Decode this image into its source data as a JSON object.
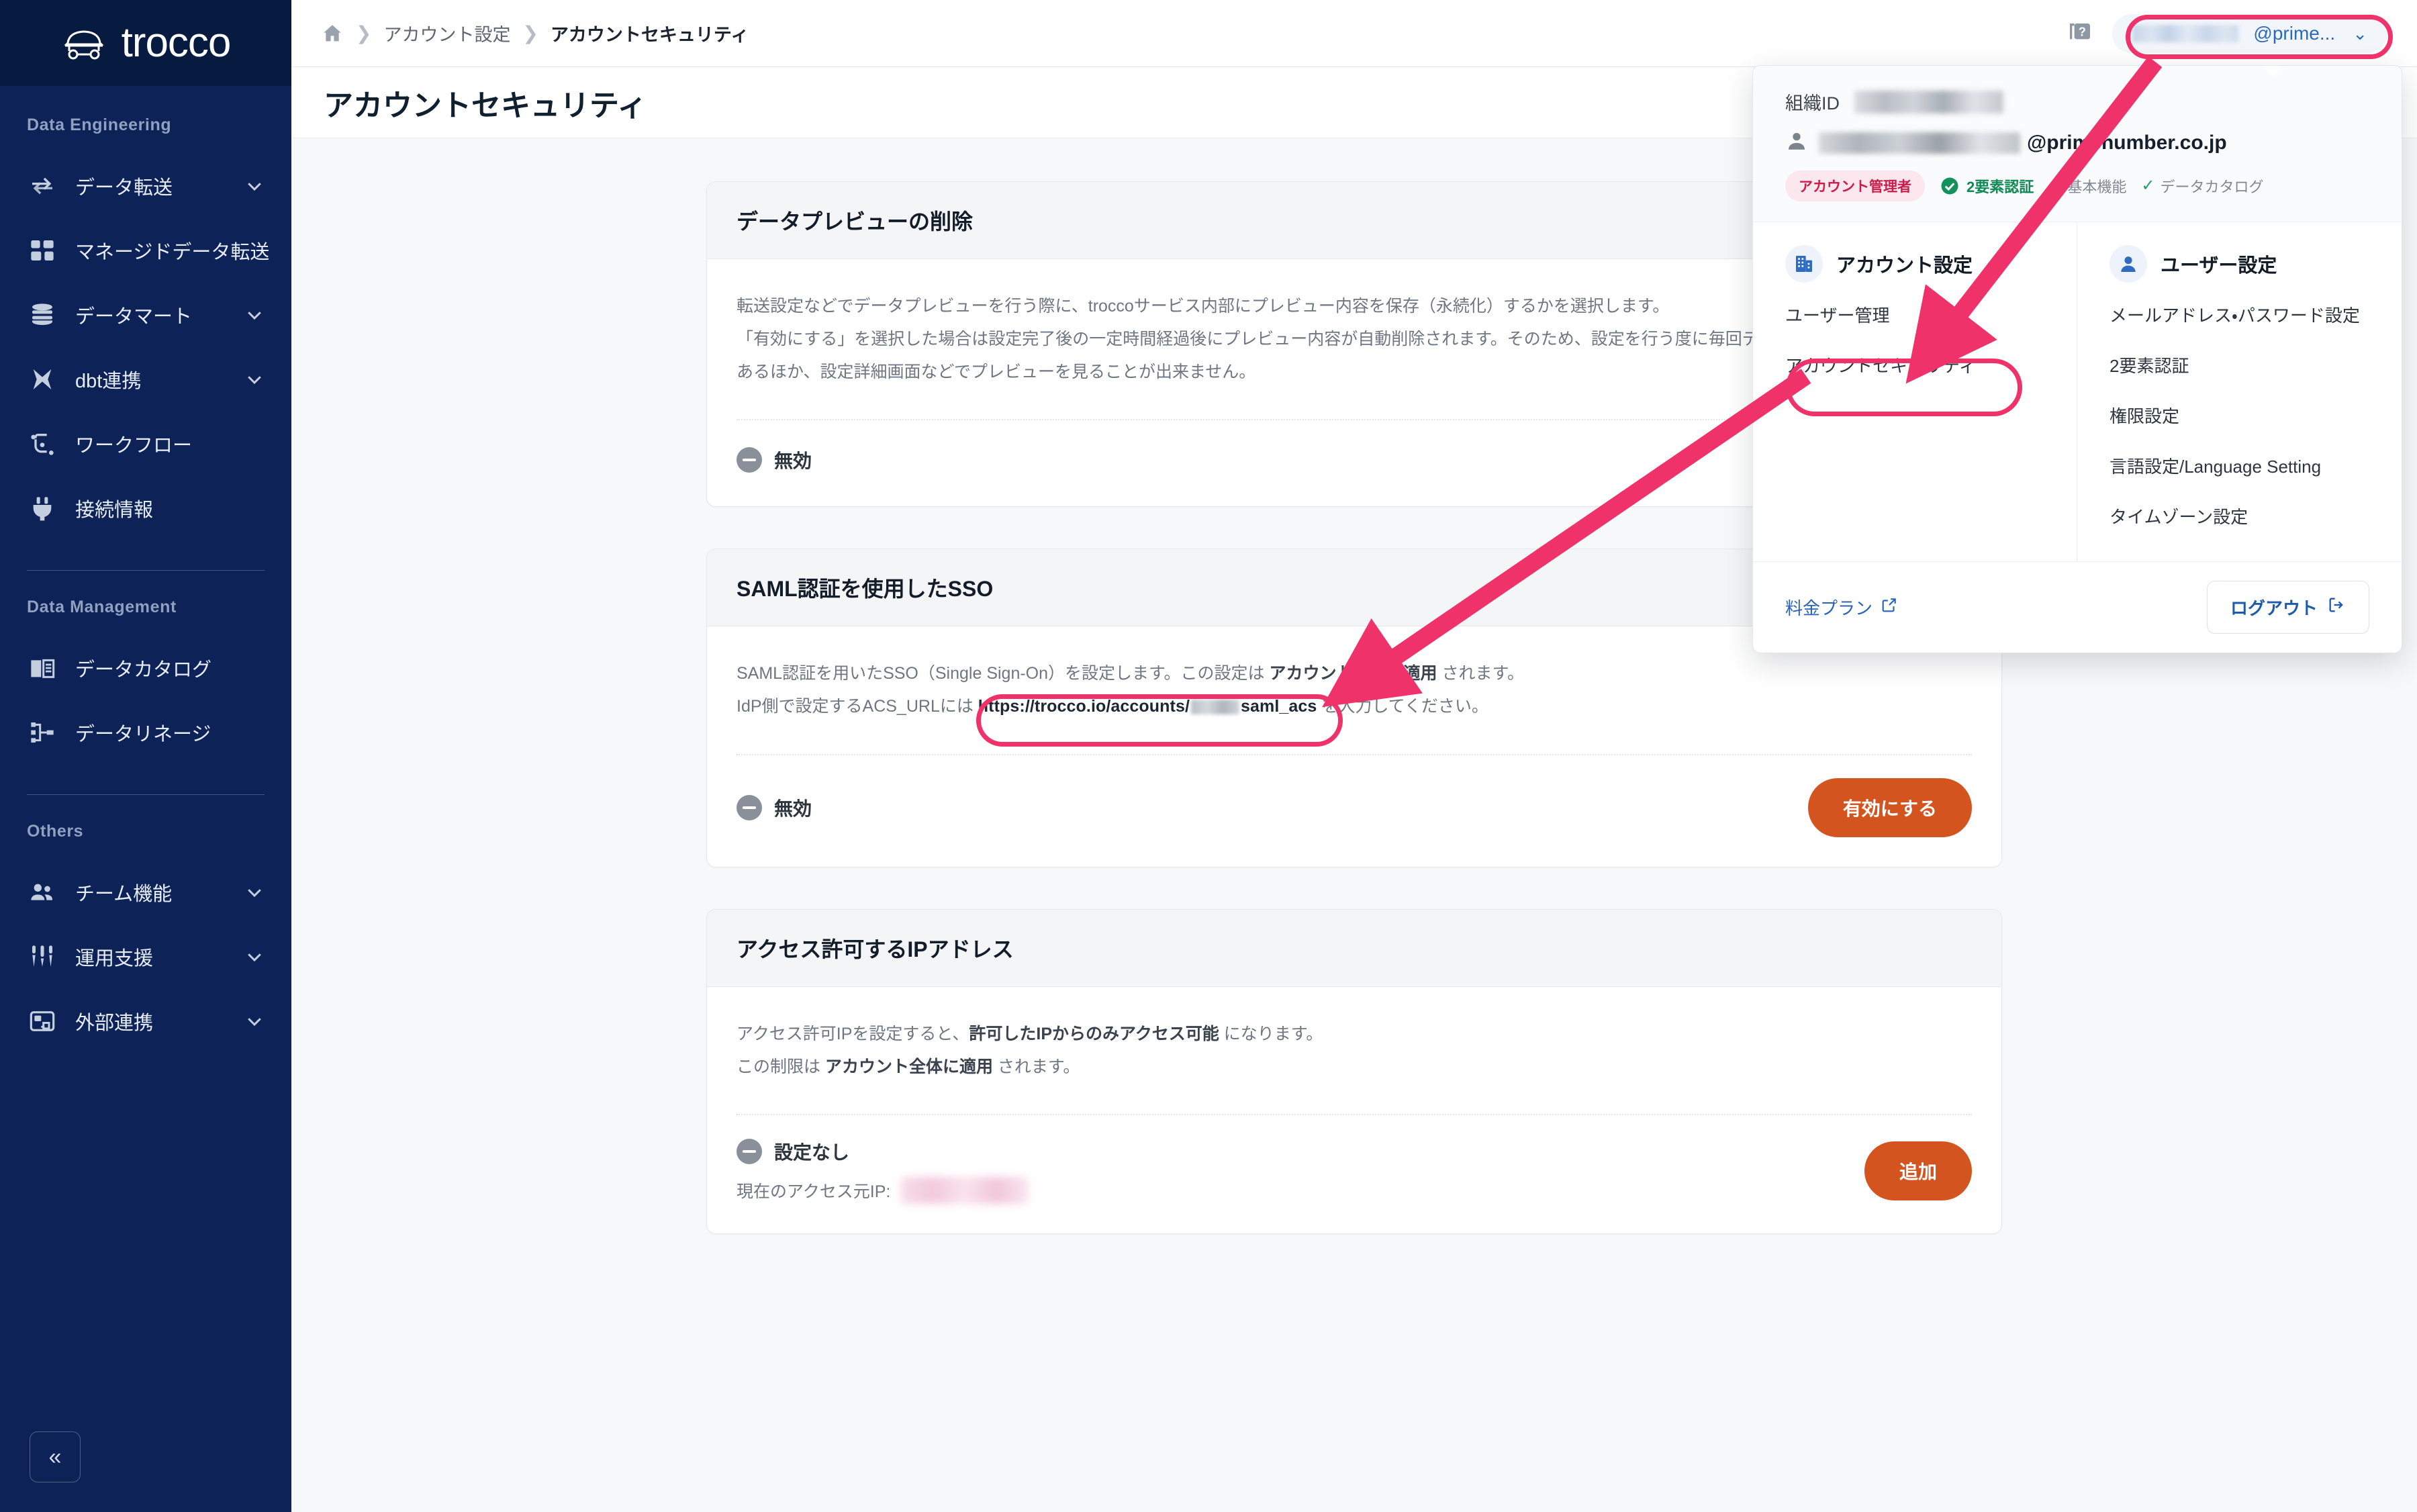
{
  "brand": {
    "name": "trocco",
    "logo_icon": "trocco-cart-icon"
  },
  "sidebar": {
    "sections": [
      {
        "label": "Data Engineering",
        "items": [
          {
            "label": "データ転送",
            "icon": "transfer-icon",
            "chevron": true
          },
          {
            "label": "マネージドデータ転送",
            "icon": "managed-transfer-icon",
            "chevron": false
          },
          {
            "label": "データマート",
            "icon": "database-icon",
            "chevron": true
          },
          {
            "label": "dbt連携",
            "icon": "dbt-icon",
            "chevron": true
          },
          {
            "label": "ワークフロー",
            "icon": "workflow-icon",
            "chevron": false
          },
          {
            "label": "接続情報",
            "icon": "plug-icon",
            "chevron": false
          }
        ]
      },
      {
        "label": "Data Management",
        "items": [
          {
            "label": "データカタログ",
            "icon": "book-icon",
            "chevron": false
          },
          {
            "label": "データリネージ",
            "icon": "lineage-icon",
            "chevron": false
          }
        ]
      },
      {
        "label": "Others",
        "items": [
          {
            "label": "チーム機能",
            "icon": "team-icon",
            "chevron": true
          },
          {
            "label": "運用支援",
            "icon": "sliders-icon",
            "chevron": true
          },
          {
            "label": "外部連携",
            "icon": "external-link-icon",
            "chevron": true
          }
        ]
      }
    ],
    "collapse_label": "«"
  },
  "topbar": {
    "breadcrumb": {
      "home_icon": "home-icon",
      "separator": "❯",
      "parent": "アカウント設定",
      "current": "アカウントセキュリティ"
    },
    "help_icon": "help-icon",
    "user_chip": {
      "text": "@prime...",
      "chevron": "⌄",
      "masked": true
    }
  },
  "page": {
    "title": "アカウントセキュリティ"
  },
  "cards": [
    {
      "title": "データプレビューの削除",
      "lines": [
        "転送設定などでデータプレビューを行う際に、troccoサービス内部にプレビュー内容を保存（永続化）するかを選択します。",
        "「有効にする」を選択した場合は設定完了後の一定時間経過後にプレビュー内容が自動削除されます。そのため、設定を行う度に毎回データプレ",
        "あるほか、設定詳細画面などでプレビューを見ることが出来ません。"
      ],
      "status": "無効",
      "status_icon": "minus-circle-icon",
      "button": null
    },
    {
      "title": "SAML認証を使用したSSO",
      "line1_prefix": "SAML認証を用いたSSO（Single Sign-On）を設定します。この設定は ",
      "line1_bold": "アカウント全体に適用",
      "line1_suffix": " されます。",
      "line2_prefix": "IdP側で設定するACS_URLには ",
      "url_prefix": "https://trocco.io/accounts/",
      "url_suffix": "saml_acs",
      "line2_suffix": " を入力してください。",
      "status": "無効",
      "status_icon": "minus-circle-icon",
      "button": "有効にする"
    },
    {
      "title": "アクセス許可するIPアドレス",
      "line1_prefix": "アクセス許可IPを設定すると、",
      "line1_bold": "許可したIPからのみアクセス可能",
      "line1_suffix": " になります。",
      "line2_prefix": "この制限は ",
      "line2_bold": "アカウント全体に適用",
      "line2_suffix": " されます。",
      "status": "設定なし",
      "status_icon": "minus-circle-icon",
      "ip_label": "現在のアクセス元IP:",
      "button": "追加"
    }
  ],
  "dropdown": {
    "org_label": "組織ID",
    "user_icon": "person-icon",
    "user_email_visible": "@primenumber.co.jp",
    "badges": {
      "role": "アカウント管理者",
      "twofa": "2要素認証",
      "twofa_icon": "check-circle-icon",
      "features": [
        "基本機能",
        "データカタログ"
      ],
      "feature_tick": "✓"
    },
    "columns": [
      {
        "title": "アカウント設定",
        "icon": "building-icon",
        "items": [
          "ユーザー管理",
          "アカウントセキュリティ"
        ]
      },
      {
        "title": "ユーザー設定",
        "icon": "person-circle-icon",
        "items": [
          "メールアドレス・パスワード設定",
          "2要素認証",
          "権限設定",
          "言語設定/Language Setting",
          "タイムゾーン設定"
        ]
      }
    ],
    "plan_link": "料金プラン",
    "plan_icon": "external-link-icon",
    "logout": "ログアウト",
    "logout_icon": "logout-icon"
  },
  "annotations": {
    "highlight_color": "#f0326b",
    "targets": [
      "user-chip",
      "dropdown-item-account-security",
      "saml-acs-url"
    ]
  },
  "colors": {
    "sidebar_bg": "#0d2357",
    "sidebar_logo_bg": "#071a40",
    "accent_orange": "#d4541f",
    "link_blue": "#2a63b4",
    "annotation_pink": "#f0326b",
    "page_bg": "#f7f8f9"
  }
}
